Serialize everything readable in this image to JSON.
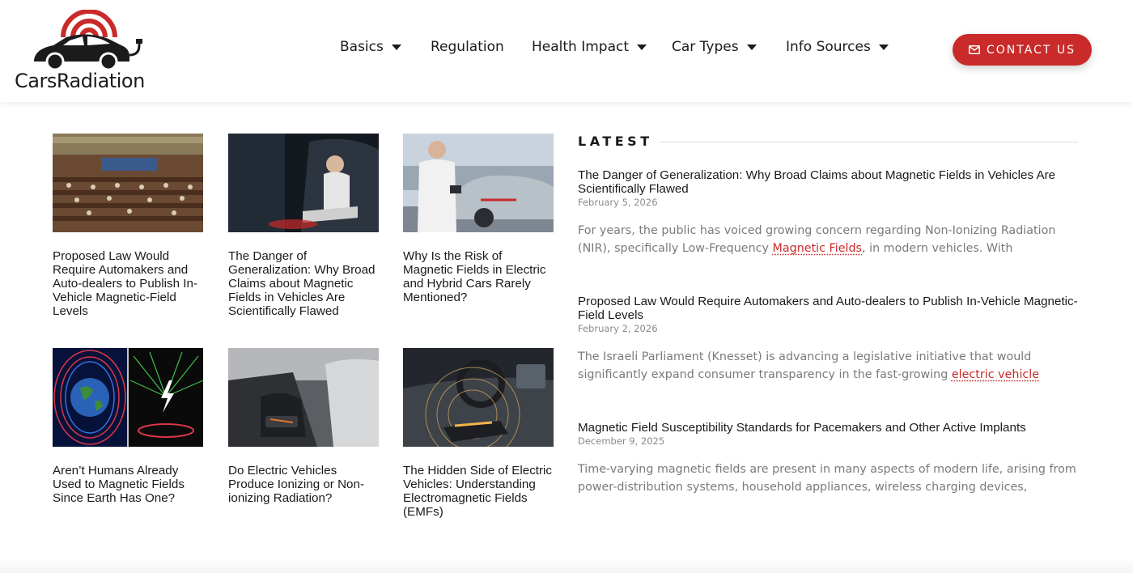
{
  "brand": {
    "name": "CarsRadiation",
    "accent": "#c92a2a"
  },
  "nav": {
    "items": [
      {
        "label": "Basics",
        "dropdown": true
      },
      {
        "label": "Regulation",
        "dropdown": false
      },
      {
        "label": "Health Impact",
        "dropdown": true
      },
      {
        "label": "Car Types",
        "dropdown": true
      },
      {
        "label": "Info Sources",
        "dropdown": true
      }
    ],
    "contact_label": "CONTACT US",
    "contact_icon": "envelope-icon"
  },
  "grid": {
    "cards": [
      {
        "title": "Proposed Law Would Require Automakers and Auto-dealers to Publish In-Vehicle Magnetic-Field Levels",
        "image": "parliament-photo"
      },
      {
        "title": "The Danger of Generalization: Why Broad Claims about Magnetic Fields in Vehicles Are Scientifically Flawed",
        "image": "woman-in-car-photo"
      },
      {
        "title": "Why Is the Risk of Magnetic Fields in Electric and Hybrid Cars Rarely Mentioned?",
        "image": "scientist-measuring-car-photo"
      },
      {
        "title": "Aren’t Humans Already Used to Magnetic Fields Since Earth Has One?",
        "image": "earth-magnetic-field-illustration"
      },
      {
        "title": "Do Electric Vehicles Produce Ionizing or Non-ionizing Radiation?",
        "image": "car-interior-floor-photo"
      },
      {
        "title": "The Hidden Side of Electric Vehicles: Understanding Electromagnetic Fields (EMFs)",
        "image": "dashboard-battery-illustration"
      }
    ]
  },
  "latest": {
    "heading": "LATEST",
    "posts": [
      {
        "title": "The Danger of Generalization: Why Broad Claims about Magnetic Fields in Vehicles Are Scientifically Flawed",
        "date": "February 5, 2026",
        "excerpt_before": "For years, the public has voiced growing concern regarding Non-Ionizing Radiation (NIR), specifically Low-Frequency ",
        "excerpt_link": "Magnetic Fields",
        "excerpt_after": ", in modern vehicles. With"
      },
      {
        "title": "Proposed Law Would Require Automakers and Auto-dealers to Publish In-Vehicle Magnetic-Field Levels",
        "date": "February 2, 2026",
        "excerpt_before": "The Israeli Parliament (Knesset) is advancing a legislative initiative that would significantly expand consumer transparency in the fast-growing ",
        "excerpt_link": "electric vehicle",
        "excerpt_after": ""
      },
      {
        "title": "Magnetic Field Susceptibility Standards for Pacemakers and Other Active Implants",
        "date": "December 9, 2025",
        "excerpt_before": "Time-varying magnetic fields are present in many aspects of modern life, arising from power-distribution systems, household appliances, wireless charging devices,",
        "excerpt_link": "",
        "excerpt_after": ""
      }
    ]
  }
}
